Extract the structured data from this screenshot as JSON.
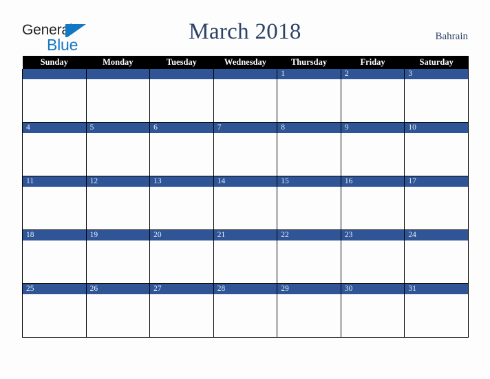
{
  "brand": {
    "name_part1": "General",
    "name_part2": "Blue",
    "mark": "blue-triangle-icon"
  },
  "header": {
    "title": "March 2018",
    "locale": "Bahrain"
  },
  "calendar": {
    "month": "March",
    "year": "2018",
    "weekday_headers": [
      "Sunday",
      "Monday",
      "Tuesday",
      "Wednesday",
      "Thursday",
      "Friday",
      "Saturday"
    ],
    "weeks": [
      [
        {
          "day": "",
          "empty": true
        },
        {
          "day": "",
          "empty": true
        },
        {
          "day": "",
          "empty": true
        },
        {
          "day": "",
          "empty": true
        },
        {
          "day": "1",
          "empty": false
        },
        {
          "day": "2",
          "empty": false
        },
        {
          "day": "3",
          "empty": false
        }
      ],
      [
        {
          "day": "4",
          "empty": false
        },
        {
          "day": "5",
          "empty": false
        },
        {
          "day": "6",
          "empty": false
        },
        {
          "day": "7",
          "empty": false
        },
        {
          "day": "8",
          "empty": false
        },
        {
          "day": "9",
          "empty": false
        },
        {
          "day": "10",
          "empty": false
        }
      ],
      [
        {
          "day": "11",
          "empty": false
        },
        {
          "day": "12",
          "empty": false
        },
        {
          "day": "13",
          "empty": false
        },
        {
          "day": "14",
          "empty": false
        },
        {
          "day": "15",
          "empty": false
        },
        {
          "day": "16",
          "empty": false
        },
        {
          "day": "17",
          "empty": false
        }
      ],
      [
        {
          "day": "18",
          "empty": false
        },
        {
          "day": "19",
          "empty": false
        },
        {
          "day": "20",
          "empty": false
        },
        {
          "day": "21",
          "empty": false
        },
        {
          "day": "22",
          "empty": false
        },
        {
          "day": "23",
          "empty": false
        },
        {
          "day": "24",
          "empty": false
        }
      ],
      [
        {
          "day": "25",
          "empty": false
        },
        {
          "day": "26",
          "empty": false
        },
        {
          "day": "27",
          "empty": false
        },
        {
          "day": "28",
          "empty": false
        },
        {
          "day": "29",
          "empty": false
        },
        {
          "day": "30",
          "empty": false
        },
        {
          "day": "31",
          "empty": false
        }
      ]
    ]
  },
  "colors": {
    "accent_blue": "#2f5597",
    "brand_blue": "#1277c4",
    "title_navy": "#2b4366",
    "header_black": "#000000",
    "page_background": "#fdfdfd",
    "daynum_text": "#e8edf6"
  }
}
